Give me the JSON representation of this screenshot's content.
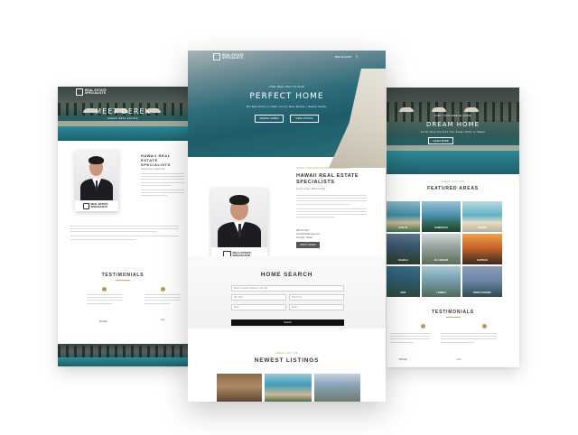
{
  "left_page": {
    "brand": "REAL ESTATE SPECIALISTS",
    "hero_title": "MEET DEREK",
    "hero_sub": "HAWAII REAL ESTATE",
    "name_small": "Derek",
    "heading_gold": "HAWAII REAL ESTATE",
    "heading": "HAWAII REAL ESTATE SPECIALISTS",
    "subline": "Derek Cortez, REALTOR",
    "badge": "REAL ESTATE SPECIALISTS",
    "testimonials_title": "TESTIMONIALS",
    "sig_1": "Michael",
    "sig_2": "Kim"
  },
  "center_page": {
    "brand": "REAL ESTATE SPECIALISTS",
    "nav_phone": "808.123.4567",
    "nav_menu": "≡",
    "hero_kicker": "FIND REAL WAY TO FIND",
    "hero_title": "PERFECT HOME",
    "hero_sub": "We Specialize in Oahu Luxury Real Estate | Hawaii Realty",
    "btn_left": "SEARCH HOMES",
    "btn_right": "VIEW LISTINGS",
    "about_kicker": "ABOUT THE REAL ESTATE SPECIALISTS",
    "about_heading_1": "HAWAII REAL ESTATE",
    "about_heading_2": "SPECIALISTS",
    "about_sub": "Derek Cortez, REALTOR(S)",
    "badge": "REAL ESTATE SPECIALISTS",
    "contact_1": "808.123.4567",
    "contact_2": "derek@hawaiirealty.com",
    "contact_3": "Honolulu, Hawaii",
    "about_button": "ABOUT DEREK",
    "search_title": "HOME SEARCH",
    "search_placeholder": "Enter Keyword, Address, City, Zip",
    "field_min": "Min Price",
    "field_max": "Max Price",
    "field_beds": "Beds",
    "field_baths": "Baths",
    "search_button": "Search",
    "listings_kicker": "CHECK OUT THE",
    "listings_title": "NEWEST LISTINGS"
  },
  "right_page": {
    "hero_kicker": "FIND YOUR DREAM HOME",
    "hero_title": "DREAM HOME",
    "hero_sub": "Let Us Help You Find Your Dream Home in Hawaii",
    "hero_button": "LEARN MORE",
    "areas_kicker": "CHECK OUT OUR",
    "areas_title": "FEATURED AREAS",
    "area_labels": [
      "KAILUA",
      "HAWAII KAI",
      "WAIKIKI",
      "KAHALA",
      "ALA MOANA",
      "KAPOLEI",
      "EWA",
      "LANIKAI",
      "NORTH SHORE"
    ],
    "testimonials_title": "TESTIMONIALS",
    "sig_1": "Michael",
    "sig_2": "Kim"
  },
  "colors": {
    "gold": "#b99a55",
    "dark_button": "#111111",
    "ocean": "#1f5c6b"
  }
}
